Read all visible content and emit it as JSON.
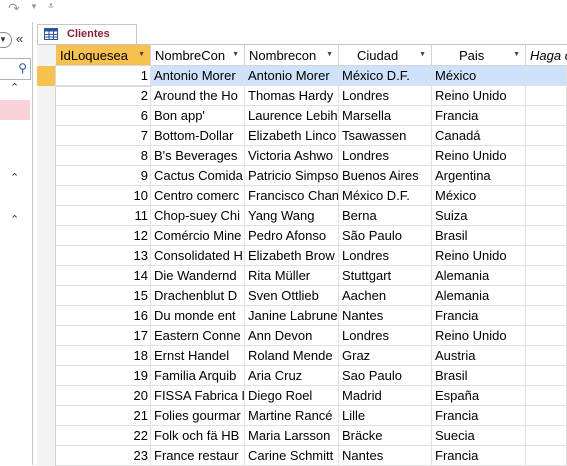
{
  "qat": {
    "redo_icon": "redo-icon",
    "dropdown_icon": "chevron-down-icon"
  },
  "nav": {
    "shutter_glyph": "«",
    "collapse_glyph": "⌃",
    "search_icon": "search-icon"
  },
  "tab": {
    "label": "Clientes",
    "icon": "table-icon"
  },
  "columns": [
    "IdLoquesea",
    "NombreCon",
    "Nombrecon",
    "Ciudad",
    "Pais",
    "Haga c"
  ],
  "rows": [
    [
      "1",
      "Antonio Morer",
      "Antonio Morer",
      "México D.F.",
      "México"
    ],
    [
      "2",
      "Around the Ho",
      "Thomas Hardy",
      "Londres",
      "Reino Unido"
    ],
    [
      "6",
      "Bon app'",
      "Laurence Lebih",
      "Marsella",
      "Francia"
    ],
    [
      "7",
      "Bottom-Dollar",
      "Elizabeth Linco",
      "Tsawassen",
      "Canadá"
    ],
    [
      "8",
      "B's Beverages",
      "Victoria Ashwo",
      "Londres",
      "Reino Unido"
    ],
    [
      "9",
      "Cactus Comida",
      "Patricio Simpso",
      "Buenos Aires",
      "Argentina"
    ],
    [
      "10",
      "Centro comerc",
      "Francisco Chan",
      "México D.F.",
      "México"
    ],
    [
      "11",
      "Chop-suey Chi",
      "Yang Wang",
      "Berna",
      "Suiza"
    ],
    [
      "12",
      "Comércio Mine",
      "Pedro Afonso",
      "São Paulo",
      "Brasil"
    ],
    [
      "13",
      "Consolidated H",
      "Elizabeth Brow",
      "Londres",
      "Reino Unido"
    ],
    [
      "14",
      "Die Wandernd",
      "Rita Müller",
      "Stuttgart",
      "Alemania"
    ],
    [
      "15",
      "Drachenblut D",
      "Sven Ottlieb",
      "Aachen",
      "Alemania"
    ],
    [
      "16",
      "Du monde ent",
      "Janine Labrune",
      "Nantes",
      "Francia"
    ],
    [
      "17",
      "Eastern Conne",
      "Ann Devon",
      "Londres",
      "Reino Unido"
    ],
    [
      "18",
      "Ernst Handel",
      "Roland Mende",
      "Graz",
      "Austria"
    ],
    [
      "19",
      "Familia Arquib",
      "Aria Cruz",
      "Sao Paulo",
      "Brasil"
    ],
    [
      "20",
      "FISSA Fabrica I",
      "Diego Roel",
      "Madrid",
      "España"
    ],
    [
      "21",
      "Folies gourmar",
      "Martine Rancé",
      "Lille",
      "Francia"
    ],
    [
      "22",
      "Folk och fä HB",
      "Maria Larsson",
      "Bräcke",
      "Suecia"
    ],
    [
      "23",
      "France restaur",
      "Carine Schmitt",
      "Nantes",
      "Francia"
    ]
  ]
}
